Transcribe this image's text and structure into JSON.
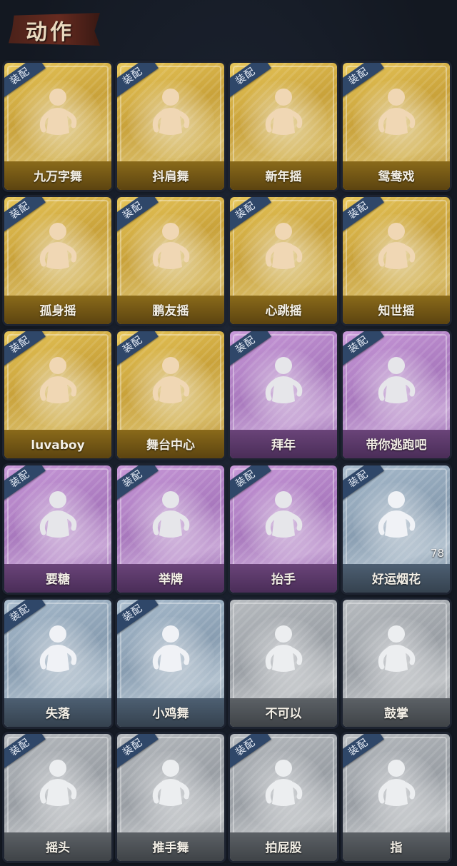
{
  "header": {
    "title": "动作"
  },
  "equip_label": "装配",
  "cards": [
    {
      "name": "九万字舞",
      "rarity": "gold",
      "equipped": true
    },
    {
      "name": "抖肩舞",
      "rarity": "gold",
      "equipped": true
    },
    {
      "name": "新年摇",
      "rarity": "gold",
      "equipped": true
    },
    {
      "name": "鸳鸯戏",
      "rarity": "gold",
      "equipped": true
    },
    {
      "name": "孤身摇",
      "rarity": "gold",
      "equipped": true
    },
    {
      "name": "鹏友摇",
      "rarity": "gold",
      "equipped": true
    },
    {
      "name": "心跳摇",
      "rarity": "gold",
      "equipped": true
    },
    {
      "name": "知世摇",
      "rarity": "gold",
      "equipped": true
    },
    {
      "name": "luvaboy",
      "rarity": "gold",
      "equipped": true
    },
    {
      "name": "舞台中心",
      "rarity": "gold",
      "equipped": true
    },
    {
      "name": "拜年",
      "rarity": "purple",
      "equipped": true
    },
    {
      "name": "带你逃跑吧",
      "rarity": "purple",
      "equipped": true
    },
    {
      "name": "要糖",
      "rarity": "purple",
      "equipped": true
    },
    {
      "name": "举牌",
      "rarity": "purple",
      "equipped": true
    },
    {
      "name": "抬手",
      "rarity": "purple",
      "equipped": true
    },
    {
      "name": "好运烟花",
      "rarity": "blue",
      "equipped": true,
      "count": "78"
    },
    {
      "name": "失落",
      "rarity": "blue",
      "equipped": true
    },
    {
      "name": "小鸡舞",
      "rarity": "blue",
      "equipped": true
    },
    {
      "name": "不可以",
      "rarity": "gray",
      "equipped": false
    },
    {
      "name": "鼓掌",
      "rarity": "gray",
      "equipped": false
    },
    {
      "name": "摇头",
      "rarity": "gray",
      "equipped": true
    },
    {
      "name": "推手舞",
      "rarity": "gray",
      "equipped": true
    },
    {
      "name": "拍屁股",
      "rarity": "gray",
      "equipped": true
    },
    {
      "name": "指",
      "rarity": "gray",
      "equipped": true
    }
  ],
  "colors": {
    "gold": "#d6b24a",
    "purple": "#b485c8",
    "blue": "#8fa3b6",
    "gray": "#a3a7ab",
    "equip_tag": "#2f4769",
    "background": "#161c28"
  }
}
